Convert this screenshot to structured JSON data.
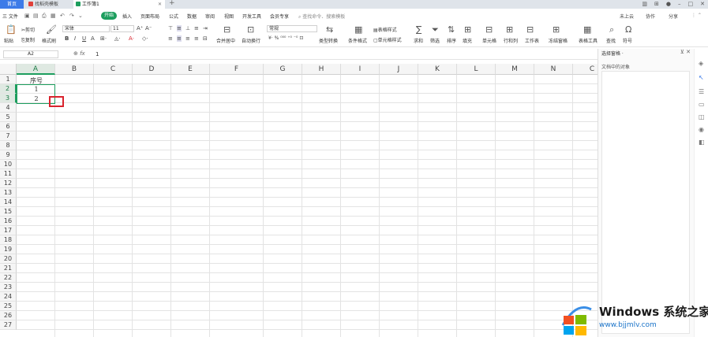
{
  "titlebar": {
    "tabs": [
      {
        "label": "首页"
      },
      {
        "label": "找稻壳模板"
      },
      {
        "label": "工作簿1"
      }
    ],
    "new_tab": "+",
    "window_controls": [
      "–",
      "□",
      "✕"
    ]
  },
  "menubar": {
    "file": "三 文件",
    "items": [
      "开始",
      "插入",
      "页面布局",
      "公式",
      "数据",
      "审阅",
      "视图",
      "开发工具",
      "会员专享"
    ],
    "search": "查找命令、搜索模板",
    "right": [
      "未上云",
      "协作",
      "分享"
    ]
  },
  "ribbon": {
    "paste": "粘贴",
    "cut": "剪切",
    "copy": "复制",
    "format_painter": "格式刷",
    "font_name": "宋体",
    "font_size": "11",
    "merge_center": "合并居中",
    "wrap_text": "自动换行",
    "number_format": "常规",
    "type_convert": "类型转换",
    "conditional_format": "条件格式",
    "table_style": "表格样式",
    "cell_style": "单元格样式",
    "sum": "求和",
    "filter": "筛选",
    "sort": "排序",
    "fill": "填充",
    "cell": "单元格",
    "rows_cols": "行和列",
    "worksheet": "工作表",
    "freeze": "冻结窗格",
    "table_tools": "表格工具",
    "find": "查找",
    "symbol": "符号"
  },
  "formulabar": {
    "name_box": "A2",
    "fx": "fx",
    "value": "1"
  },
  "sheet": {
    "columns": [
      "A",
      "B",
      "C",
      "D",
      "E",
      "F",
      "G",
      "H",
      "I",
      "J",
      "K",
      "L",
      "M",
      "N",
      "C"
    ],
    "rows": [
      "1",
      "2",
      "3",
      "4",
      "5",
      "6",
      "7",
      "8",
      "9",
      "10",
      "11",
      "12",
      "13",
      "14",
      "15",
      "16",
      "17",
      "18",
      "19",
      "20",
      "21",
      "22",
      "23",
      "24",
      "25",
      "26",
      "27"
    ],
    "cells": {
      "A1": "序号",
      "A2": "1",
      "A3": "2"
    }
  },
  "right_pane": {
    "title": "选择窗格 ·",
    "label": "文档中的对象"
  },
  "watermark": {
    "title": "Windows 系统之家",
    "url": "www.bjjmlv.com",
    "colors": [
      "#f25022",
      "#7fba00",
      "#00a4ef",
      "#ffb900"
    ]
  },
  "colors": {
    "accent": "#1d9e5e",
    "highlight": "#d9232d",
    "home_tab": "#3d7be8"
  }
}
